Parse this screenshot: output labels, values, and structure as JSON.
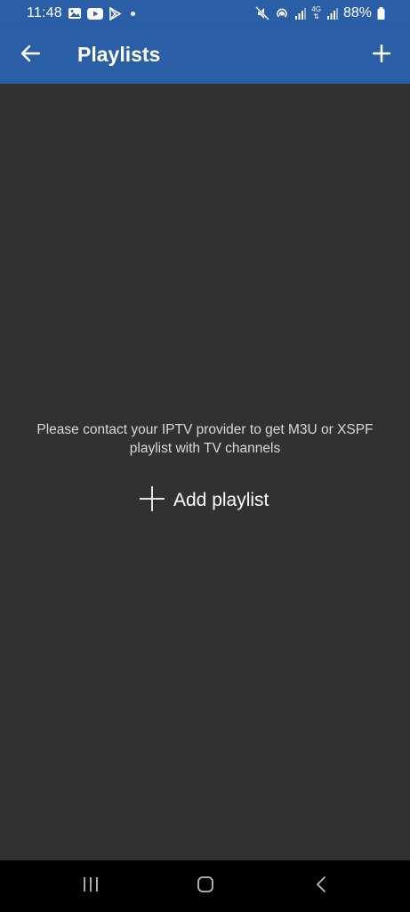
{
  "status_bar": {
    "time": "11:48",
    "battery": "88%",
    "network_label_top": "4G",
    "icons": [
      "gallery-icon",
      "youtube-icon",
      "play-store-icon",
      "notification-dot-icon",
      "mute-icon",
      "hotspot-icon",
      "signal-icon",
      "signal-icon",
      "battery-icon"
    ]
  },
  "app_bar": {
    "title": "Playlists",
    "back_icon": "arrow-back-icon",
    "add_icon": "plus-icon"
  },
  "main": {
    "empty_message": "Please contact your IPTV provider to get M3U or XSPF playlist with TV channels",
    "add_playlist_label": "Add playlist"
  },
  "nav_bar": {
    "icons": [
      "recent-apps-icon",
      "home-icon",
      "back-icon"
    ]
  },
  "colors": {
    "app_bar": "#2a5ea6",
    "background": "#313131",
    "nav_bar": "#000000",
    "text": "#ffffff"
  }
}
